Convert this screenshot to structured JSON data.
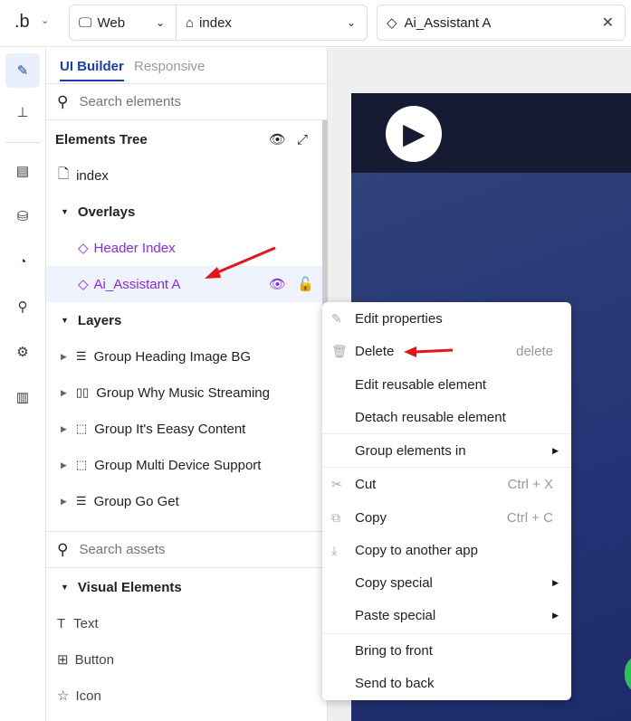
{
  "topbar": {
    "logo": ".b",
    "platform": "Web",
    "page": "index",
    "element": "Ai_Assistant A"
  },
  "rail": [
    "edit-icon",
    "sitemap-icon",
    "layout-icon",
    "database-icon",
    "palette-icon",
    "plug-icon",
    "settings-icon",
    "chart-icon"
  ],
  "panel": {
    "tabs": [
      "UI Builder",
      "Responsive"
    ],
    "search_placeholder": "Search elements",
    "tree_title": "Elements Tree",
    "index": "index",
    "overlays": "Overlays",
    "overlay_items": [
      "Header Index",
      "Ai_Assistant A"
    ],
    "layers": "Layers",
    "layer_items": [
      {
        "label": "Group Heading Image BG",
        "icon": "rows-icon"
      },
      {
        "label": "Group Why Music Streaming",
        "icon": "columns-icon"
      },
      {
        "label": "Group It's Eeasy Content",
        "icon": "dashed-box-icon"
      },
      {
        "label": "Group Multi Device Support",
        "icon": "dashed-box-icon"
      },
      {
        "label": "Group Go Get",
        "icon": "rows-icon"
      }
    ],
    "assets_placeholder": "Search assets",
    "visual_title": "Visual Elements",
    "visual_items": [
      "Text",
      "Button",
      "Icon"
    ]
  },
  "menu": {
    "items": [
      {
        "label": "Edit properties",
        "icon": "✎",
        "shortcut": ""
      },
      {
        "label": "Delete",
        "icon": "🗑",
        "shortcut": "delete"
      },
      {
        "label": "Edit reusable element",
        "shortcut": ""
      },
      {
        "label": "Detach reusable element",
        "shortcut": ""
      },
      {
        "label": "Group elements in",
        "submenu": true
      },
      {
        "label": "Cut",
        "icon": "✂",
        "shortcut": "Ctrl + X"
      },
      {
        "label": "Copy",
        "icon": "⧉",
        "shortcut": "Ctrl + C"
      },
      {
        "label": "Copy to another app",
        "icon": "⤓",
        "shortcut": ""
      },
      {
        "label": "Copy special",
        "submenu": true
      },
      {
        "label": "Paste special",
        "submenu": true
      },
      {
        "label": "Bring to front"
      },
      {
        "label": "Send to back"
      }
    ]
  },
  "colors": {
    "accent": "#1a3fb0",
    "purple": "#8a2be2",
    "selected_row": "#eef3fd",
    "arrow": "#e8141b"
  }
}
